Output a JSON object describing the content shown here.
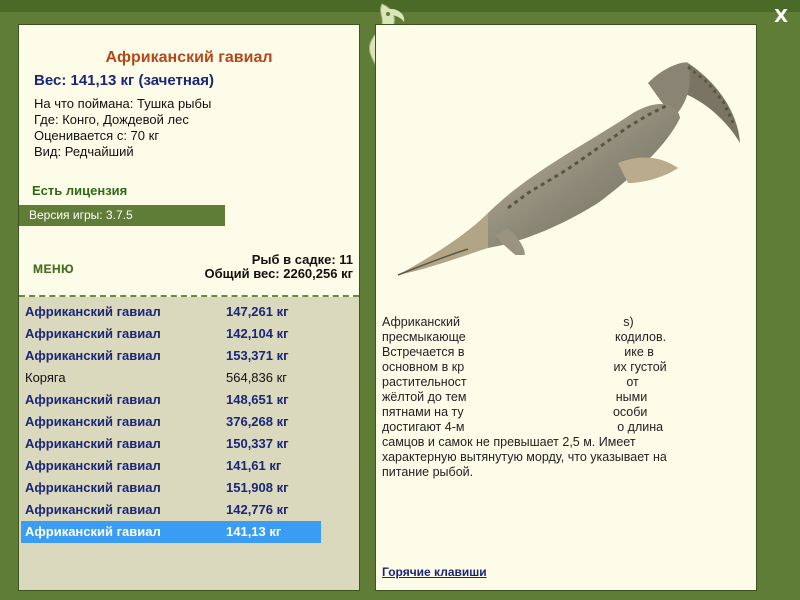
{
  "window": {
    "close_label": "X"
  },
  "fish": {
    "title": "Африканский гавиал",
    "weight_line": "Вес: 141,13 кг (зачетная)",
    "details": [
      "На что поймана: Тушка рыбы",
      "Где: Конго, Дождевой лес",
      "Оценивается с: 70 кг",
      "Вид: Редчайший"
    ],
    "license": "Есть лицензия",
    "version": "Версия игры: 3.7.5"
  },
  "menu": {
    "label": "МЕНЮ"
  },
  "cage": {
    "count": "Рыб в садке: 11",
    "total": "Общий вес: 2260,256 кг"
  },
  "catches": [
    {
      "name": "Африканский гавиал",
      "weight": "147,261 кг",
      "type": "fish"
    },
    {
      "name": "Африканский гавиал",
      "weight": "142,104 кг",
      "type": "fish"
    },
    {
      "name": "Африканский гавиал",
      "weight": "153,371 кг",
      "type": "fish"
    },
    {
      "name": "Коряга",
      "weight": "564,836 кг",
      "type": "junk"
    },
    {
      "name": "Африканский гавиал",
      "weight": "148,651 кг",
      "type": "fish"
    },
    {
      "name": "Африканский гавиал",
      "weight": "376,268 кг",
      "type": "fish"
    },
    {
      "name": "Африканский гавиал",
      "weight": "150,337 кг",
      "type": "fish"
    },
    {
      "name": "Африканский гавиал",
      "weight": "141,61 кг",
      "type": "fish"
    },
    {
      "name": "Африканский гавиал",
      "weight": "151,908 кг",
      "type": "fish"
    },
    {
      "name": "Африканский гавиал",
      "weight": "142,776 кг",
      "type": "fish"
    },
    {
      "name": "Африканский гавиал",
      "weight": "141,13 кг",
      "type": "fish",
      "selected": true
    }
  ],
  "description": {
    "lines": [
      "Африканский                                               s)",
      "пресмыкающе                                           кодилов.",
      "Встречается в                                              ике в",
      "основном в кр                                           их густой",
      "растительност                                              от",
      "жёлтой до тем                                           ными",
      "пятнами на ту                                           особи",
      "достигают 4-м                                            о длина",
      "самцов и самок не превышает 2,5 м. Имеет",
      "характерную вытянутую морду, что указывает на",
      "питание рыбой."
    ]
  },
  "hotkeys": {
    "label": "Горячие клавиши"
  },
  "colors": {
    "frame": "#5f7d36",
    "panel": "#fdfce8",
    "list_bg": "#dad9be",
    "fish_text": "#1a2678",
    "title_text": "#b5481b",
    "license_text": "#2f6b14",
    "selected_row": "#3b9cf4"
  }
}
